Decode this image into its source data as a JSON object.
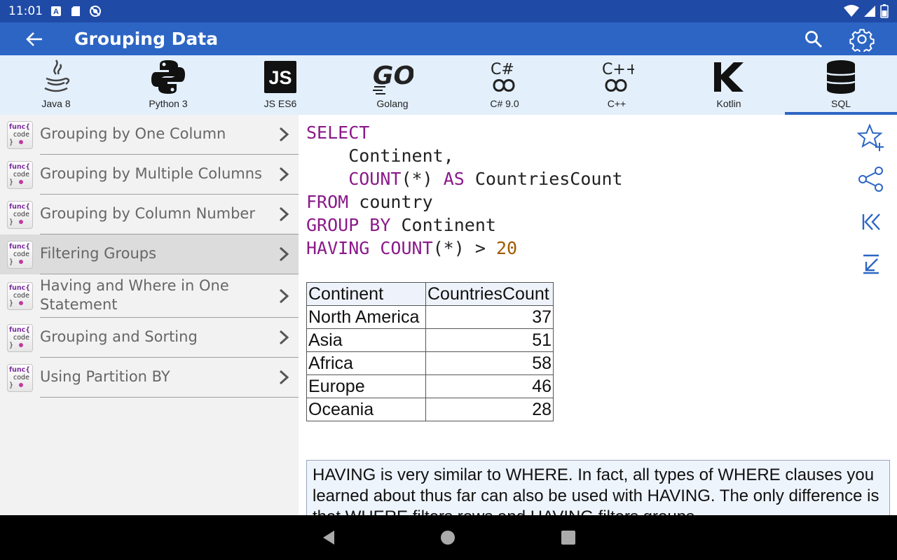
{
  "status": {
    "time": "11:01",
    "left_icons": [
      "a-badge-icon",
      "sd-card-icon",
      "sync-disabled-icon"
    ],
    "right_icons": [
      "wifi-icon",
      "signal-icon",
      "battery-icon"
    ]
  },
  "appbar": {
    "title": "Grouping Data",
    "back_icon": "arrow-back-icon",
    "search_icon": "search-icon",
    "settings_icon": "gear-icon"
  },
  "languages": [
    {
      "name": "Java 8",
      "icon": "java-logo-icon"
    },
    {
      "name": "Python 3",
      "icon": "python-logo-icon"
    },
    {
      "name": "JS ES6",
      "icon": "js-logo-icon"
    },
    {
      "name": "Golang",
      "icon": "go-logo-icon"
    },
    {
      "name": "C# 9.0",
      "icon": "csharp-logo-icon"
    },
    {
      "name": "C++",
      "icon": "cpp-logo-icon"
    },
    {
      "name": "Kotlin",
      "icon": "kotlin-logo-icon"
    },
    {
      "name": "SQL",
      "icon": "database-icon",
      "selected": true
    }
  ],
  "sidebar": {
    "icon_text": {
      "line1": "func{",
      "line2": "code",
      "line3": "}"
    },
    "items": [
      {
        "label": "Grouping by One Column"
      },
      {
        "label": "Grouping by Multiple Columns"
      },
      {
        "label": "Grouping by Column Number"
      },
      {
        "label": "Filtering Groups",
        "selected": true
      },
      {
        "label": "Having and Where in One Statement"
      },
      {
        "label": "Grouping and Sorting"
      },
      {
        "label": "Using Partition BY"
      }
    ]
  },
  "code": {
    "l1_kw": "SELECT",
    "l2": "    Continent,",
    "l3_kw1": "    COUNT",
    "l3_t1": "(*) ",
    "l3_kw2": "AS",
    "l3_t2": " CountriesCount",
    "l4_kw": "FROM",
    "l4_t": " country",
    "l5_kw": "GROUP BY",
    "l5_t": " Continent",
    "l6_kw": "HAVING COUNT",
    "l6_t": "(*) > ",
    "l6_num": "20"
  },
  "result": {
    "headers": [
      "Continent",
      "CountriesCount"
    ],
    "rows": [
      [
        "North America",
        "37"
      ],
      [
        "Asia",
        "51"
      ],
      [
        "Africa",
        "58"
      ],
      [
        "Europe",
        "46"
      ],
      [
        "Oceania",
        "28"
      ]
    ]
  },
  "note": "HAVING is very similar to WHERE. In fact, all types of WHERE clauses you learned about thus far can also be used with HAVING. The only difference is that WHERE filters rows and HAVING filters groups.",
  "tools": [
    "star-add-icon",
    "share-icon",
    "skip-first-icon",
    "arrow-down-left-icon"
  ],
  "colors": {
    "status_bar": "#1f4aa6",
    "app_bar": "#2c65c4",
    "lang_bar": "#e3effb",
    "sidebar": "#f2f2f2",
    "sidebar_selected": "#dcdcdc",
    "keyword": "#8a1a8a",
    "number": "#a05a00",
    "tool_icon": "#2c65c4"
  },
  "nav": [
    "back-triangle-icon",
    "home-circle-icon",
    "recents-square-icon"
  ]
}
